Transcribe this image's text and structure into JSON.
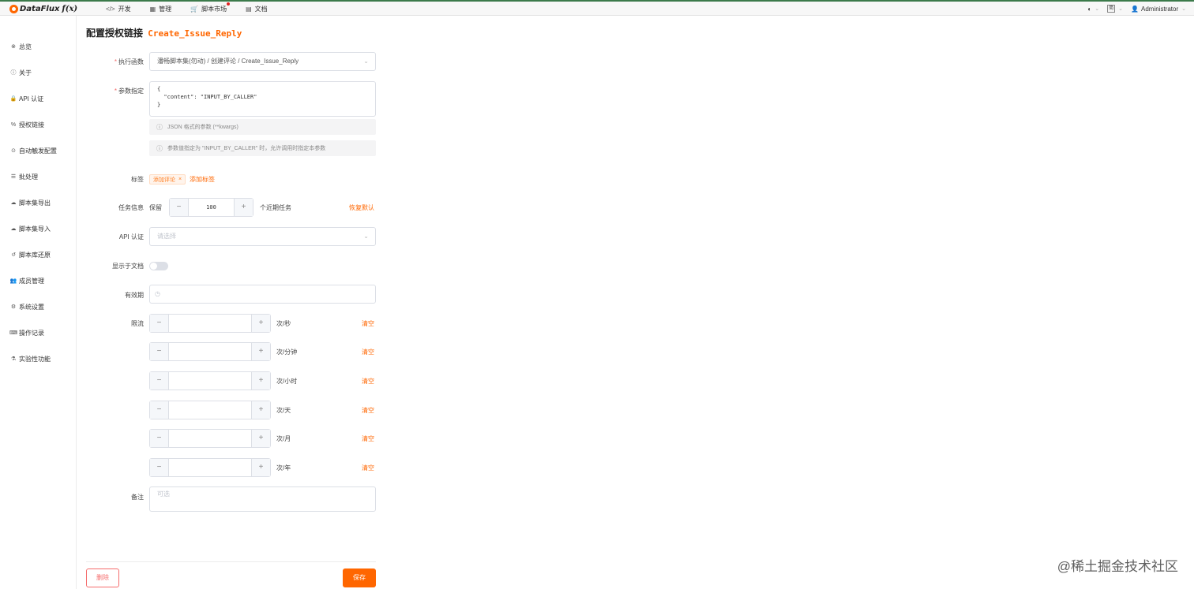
{
  "brand": {
    "name": "DataFlux",
    "suffix": "f(x)"
  },
  "nav": [
    {
      "icon": "</>",
      "label": "开发"
    },
    {
      "icon": "▦",
      "label": "管理"
    },
    {
      "icon": "🛒",
      "label": "脚本市场"
    },
    {
      "icon": "▤",
      "label": "文档"
    }
  ],
  "topRight": {
    "themeIcon": "◐",
    "lang": "简",
    "user": "Administrator"
  },
  "sidebar": [
    {
      "icon": "⊗",
      "label": "总览"
    },
    {
      "icon": "ⓘ",
      "label": "关于"
    },
    {
      "icon": "🔒",
      "label": "API 认证"
    },
    {
      "icon": "%",
      "label": "授权链接"
    },
    {
      "icon": "⊙",
      "label": "自动触发配置"
    },
    {
      "icon": "☰",
      "label": "批处理"
    },
    {
      "icon": "☁",
      "label": "脚本集导出"
    },
    {
      "icon": "☁",
      "label": "脚本集导入"
    },
    {
      "icon": "↺",
      "label": "脚本库还原"
    },
    {
      "icon": "👥",
      "label": "成员管理"
    },
    {
      "icon": "⚙",
      "label": "系统设置"
    },
    {
      "icon": "⌨",
      "label": "操作记录"
    },
    {
      "icon": "⚗",
      "label": "实验性功能"
    }
  ],
  "title": {
    "text": "配置授权链接",
    "func": "Create_Issue_Reply"
  },
  "form": {
    "func": {
      "label": "执行函数",
      "value": "潘畅脚本集(勿动) / 创建评论 / Create_Issue_Reply"
    },
    "args": {
      "label": "参数指定",
      "line1": "{",
      "line2": "  \"content\": \"INPUT_BY_CALLER\"",
      "line3": "}",
      "hint1": "JSON 格式的参数 (**kwargs)",
      "hint2": "参数值指定为 \"INPUT_BY_CALLER\" 时，允许调用时指定本参数"
    },
    "tags": {
      "label": "标签",
      "tag": "添加评论",
      "add": "添加标签"
    },
    "taskInfo": {
      "label": "任务信息",
      "prefix": "保留",
      "value": "100",
      "suffix": "个近期任务",
      "reset": "恢复默认"
    },
    "apiAuth": {
      "label": "API 认证",
      "placeholder": "请选择"
    },
    "showInDoc": {
      "label": "显示于文档"
    },
    "expire": {
      "label": "有效期"
    },
    "throttling": {
      "label": "限流",
      "clear": "清空",
      "units": [
        "次/秒",
        "次/分钟",
        "次/小时",
        "次/天",
        "次/月",
        "次/年"
      ]
    },
    "note": {
      "label": "备注",
      "placeholder": "可选"
    }
  },
  "buttons": {
    "delete": "删除",
    "save": "保存"
  },
  "watermark": "@稀土掘金技术社区"
}
